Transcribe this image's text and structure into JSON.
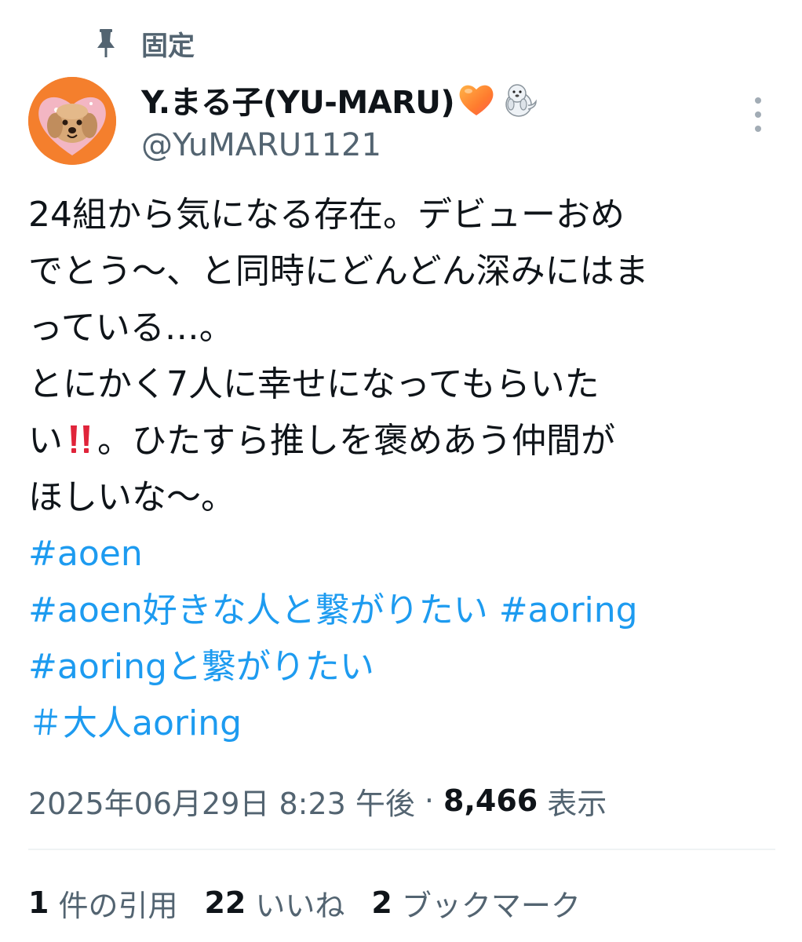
{
  "pinned": {
    "icon": "pin-icon",
    "label": "固定"
  },
  "author": {
    "display_name": "Y.まる子(YU-MARU)",
    "emojis": [
      "orange-heart-emoji",
      "seal-emoji"
    ],
    "handle": "@YuMARU1121",
    "avatar": "dog-avatar",
    "avatar_bg": "#f47f2d"
  },
  "more_button": {
    "icon": "more-vertical-icon"
  },
  "tweet": {
    "lines": [
      "24組から気になる存在。デビューおめ",
      "でとう～、と同時にどんどん深みにはま",
      "っている…。",
      "とにかく7人に幸せになってもらいた",
      "",
      "ほしいな～。"
    ],
    "line5_prefix": "い",
    "line5_emoji": "double-exclamation-emoji",
    "line5_suffix": "。ひたすら推しを褒めあう仲間が",
    "hashtags": [
      "#aoen",
      "#aoen好きな人と繋がりたい #aoring",
      "#aoringと繋がりたい",
      "＃大人aoring"
    ]
  },
  "meta": {
    "timestamp": "2025年06月29日 8:23 午後",
    "separator": "·",
    "views": "8,466",
    "views_label": "表示"
  },
  "stats": {
    "quotes_num": "1",
    "quotes_label": "件の引用",
    "likes_num": "22",
    "likes_label": "いいね",
    "bookmarks_num": "2",
    "bookmarks_label": "ブックマーク"
  },
  "colors": {
    "text": "#0f1419",
    "secondary": "#536471",
    "link": "#1d9bf0",
    "divider": "#eff3f4"
  }
}
